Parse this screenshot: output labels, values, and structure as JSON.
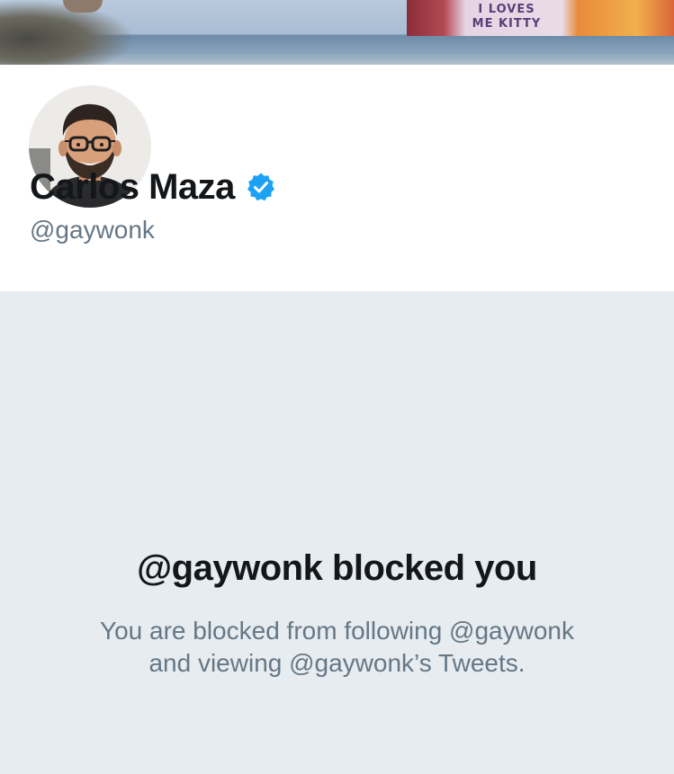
{
  "banner": {
    "shirt_text_line1": "I LOVES",
    "shirt_text_line2": "ME KITTY"
  },
  "profile": {
    "display_name": "Carlos Maza",
    "handle": "@gaywonk",
    "verified": true,
    "verified_icon": "verified-badge-icon",
    "accent_color": "#1da1f2"
  },
  "blocked": {
    "title": "@gaywonk blocked you",
    "message_line1": "You are blocked from following @gaywonk",
    "message_line2": "and viewing @gaywonk’s Tweets."
  },
  "colors": {
    "primary_text": "#14171a",
    "secondary_text": "#657786",
    "blocked_background": "#e6ecf0"
  }
}
